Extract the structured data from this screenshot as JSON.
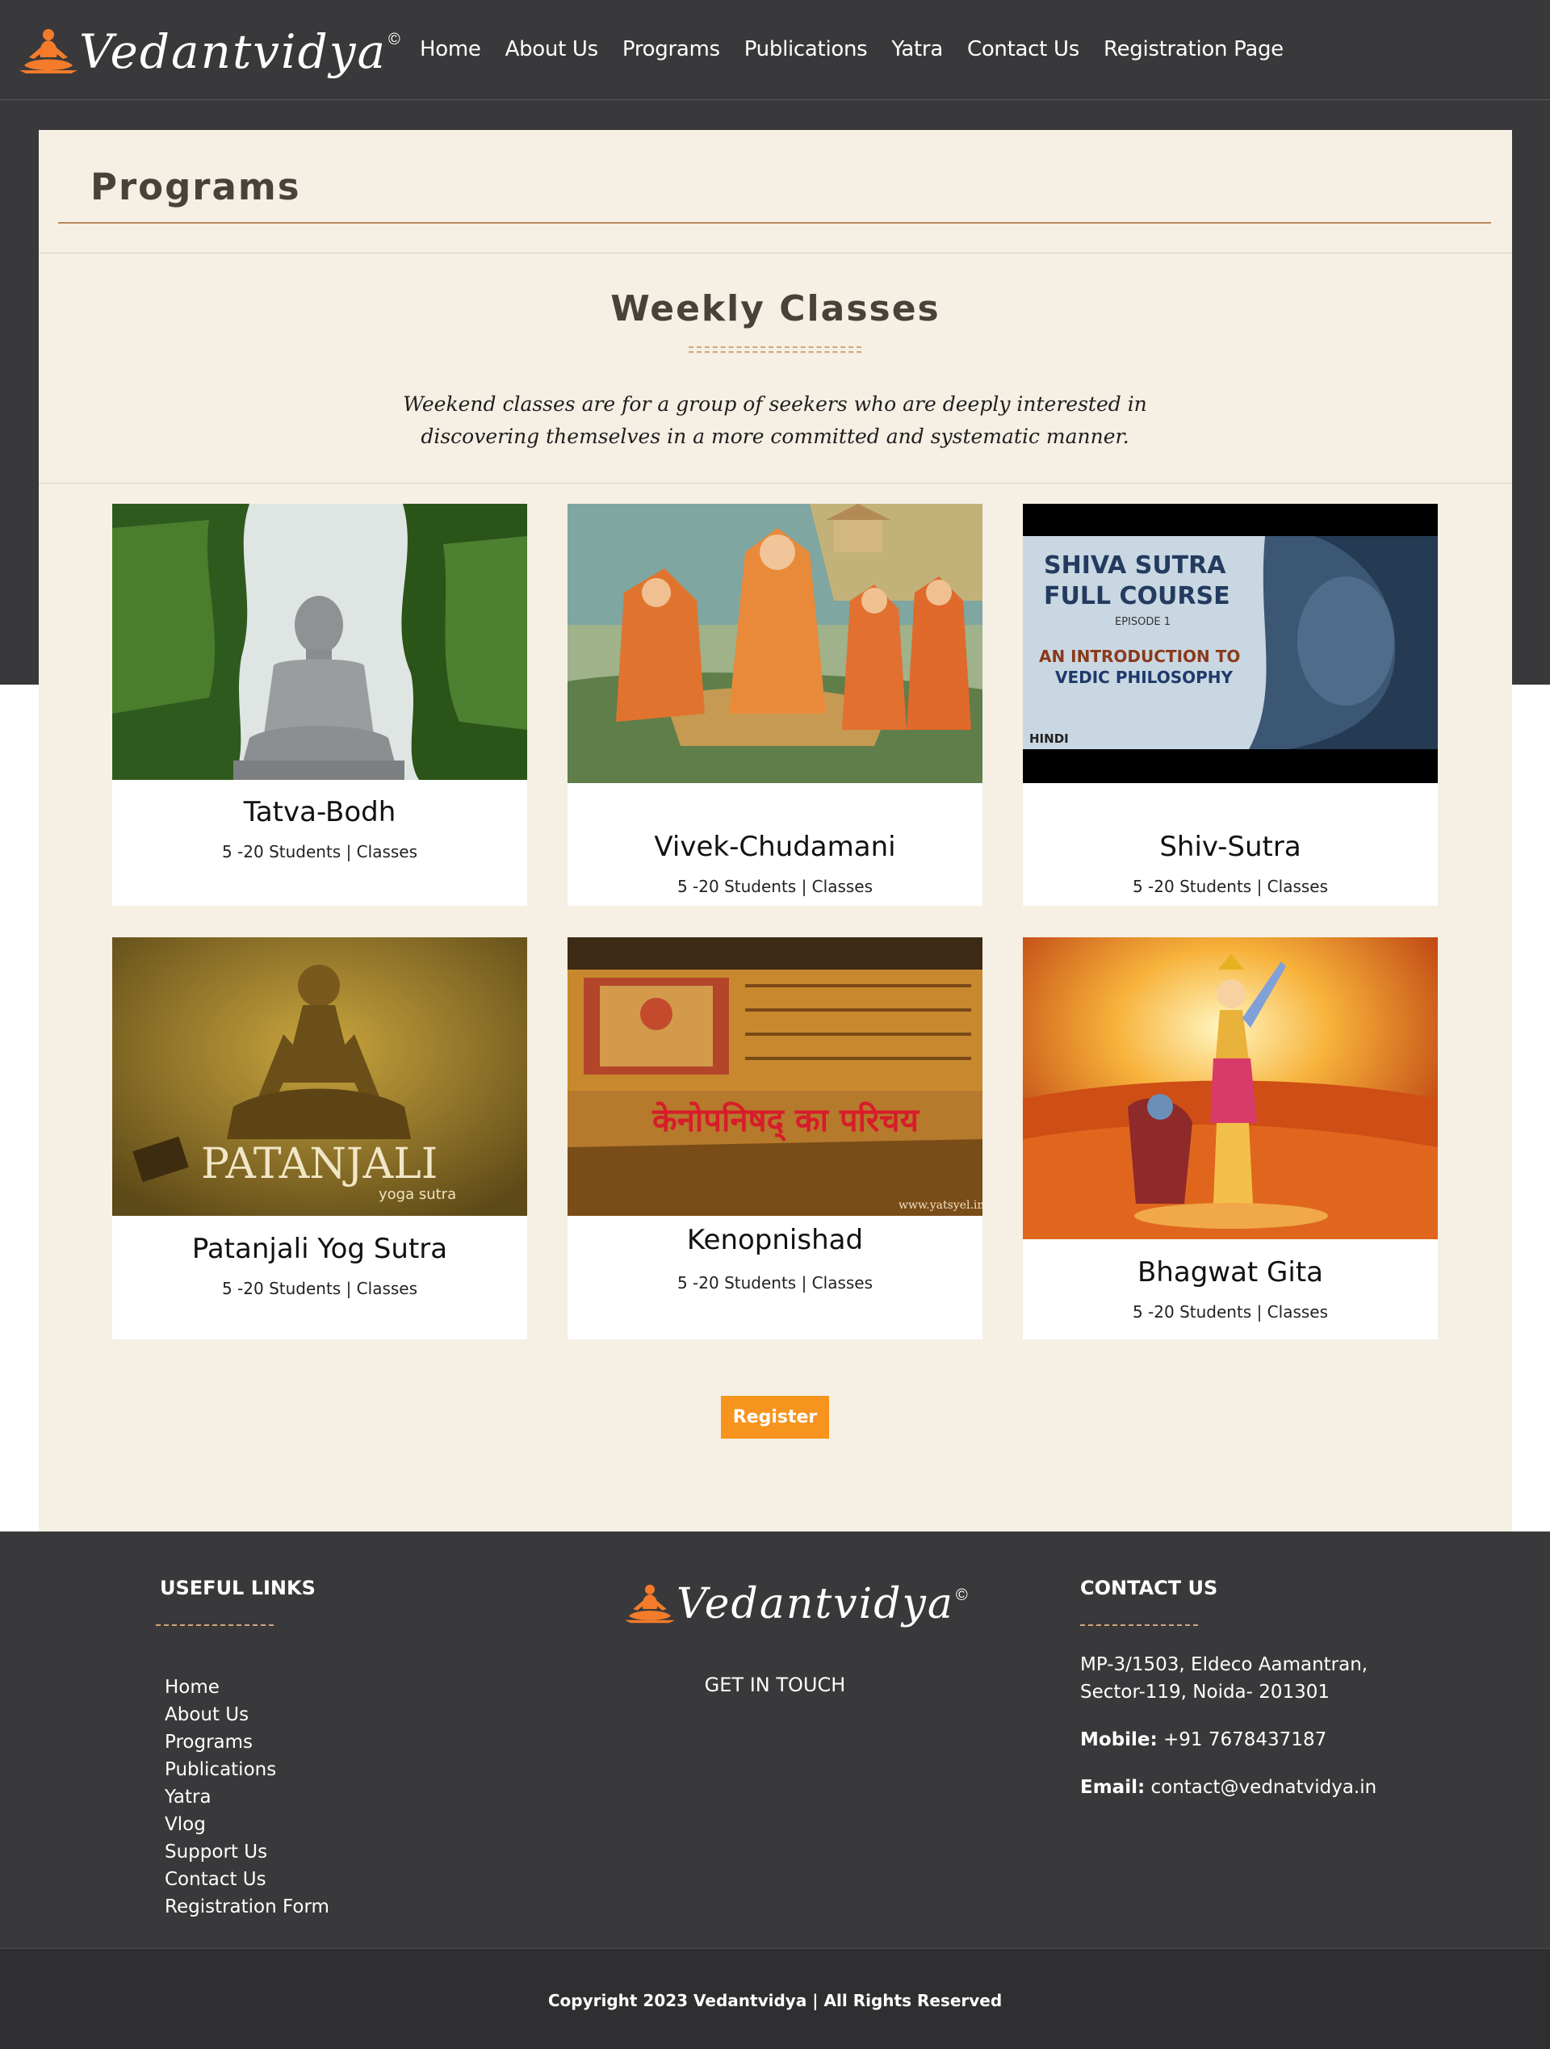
{
  "brand": {
    "name": "Vedantvidya",
    "copy_symbol": "©"
  },
  "nav": {
    "items": [
      "Home",
      "About Us",
      "Programs",
      "Publications",
      "Yatra",
      "Contact Us",
      "Registration Page"
    ]
  },
  "page": {
    "title": "Programs"
  },
  "section": {
    "heading": "Weekly Classes",
    "intro": "Weekend classes are for a group of seekers who are deeply interested in discovering themselves in a more committed and systematic manner."
  },
  "cards": [
    {
      "title": "Tatva-Bodh",
      "meta": "5 -20 Students | Classes"
    },
    {
      "title": "Vivek-Chudamani",
      "meta": "5 -20 Students | Classes"
    },
    {
      "title": "Shiv-Sutra",
      "meta": "5 -20 Students | Classes",
      "image_text": {
        "line1": "SHIVA SUTRA",
        "line2": "FULL COURSE",
        "episode": "EPISODE 1",
        "sub1": "AN INTRODUCTION TO",
        "sub2": "VEDIC PHILOSOPHY",
        "tag": "HINDI"
      }
    },
    {
      "title": "Patanjali Yog Sutra",
      "meta": "5 -20 Students | Classes",
      "image_text": {
        "main": "PATANJALI",
        "sub": "yoga sutra"
      }
    },
    {
      "title": "Kenopnishad",
      "meta": "5 -20 Students | Classes",
      "image_text": {
        "main": "केनोपनिषद् का परिचय",
        "credit": "www.yatsyel.in"
      }
    },
    {
      "title": "Bhagwat Gita",
      "meta": "5 -20 Students | Classes"
    }
  ],
  "register": {
    "label": "Register"
  },
  "footer": {
    "useful_links_heading": "USEFUL LINKS",
    "links": [
      "Home",
      "About Us",
      "Programs",
      "Publications",
      "Yatra",
      "Vlog",
      "Support Us",
      "Contact Us",
      "Registration Form"
    ],
    "get_in_touch": "GET IN TOUCH",
    "contact_heading": "CONTACT US",
    "address_line1": "MP-3/1503, Eldeco Aamantran,",
    "address_line2": "Sector-119, Noida- 201301",
    "mobile_label": "Mobile:",
    "mobile": "+91 7678437187",
    "email_label": "Email:",
    "email": "contact@vednatvidya.in",
    "copyright": "Copyright 2023 Vedantvidya | All Rights Reserved"
  },
  "colors": {
    "header_bg": "#39393b",
    "content_bg": "#f5efe4",
    "accent": "#f7941d",
    "rule": "#b8895a"
  }
}
